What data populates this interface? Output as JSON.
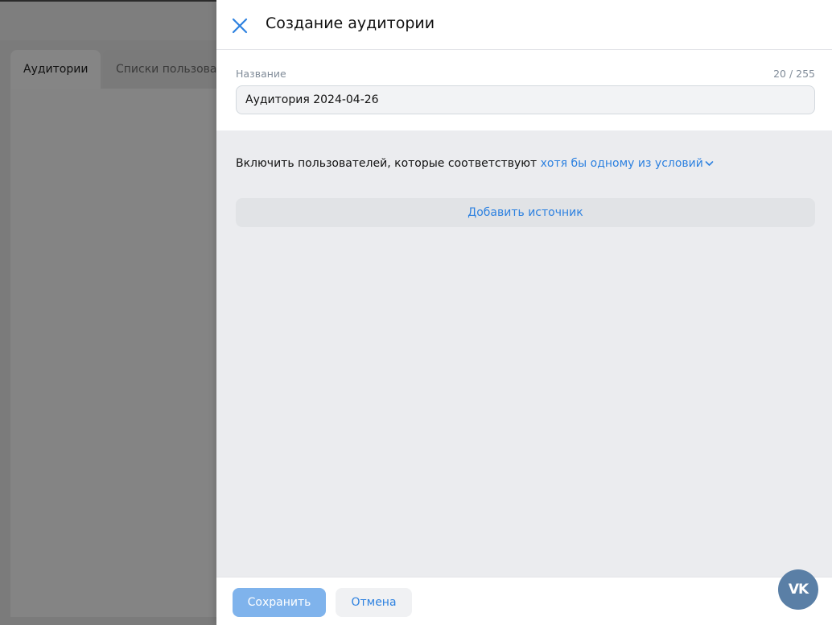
{
  "background": {
    "tabs": [
      {
        "label": "Аудитории",
        "active": true
      },
      {
        "label": "Списки пользоват",
        "active": false
      }
    ]
  },
  "modal": {
    "title": "Создание аудитории",
    "name_field": {
      "label": "Название",
      "counter": "20 / 255",
      "value": "Аудитория 2024-04-26"
    },
    "condition": {
      "prefix": "Включить пользователей, которые соответствуют",
      "selected": "хотя бы одному из условий"
    },
    "add_source_label": "Добавить источник",
    "footer": {
      "save_label": "Сохранить",
      "cancel_label": "Отмена"
    }
  },
  "fab": {
    "label": "VK",
    "icon": "vk-logo-icon"
  },
  "colors": {
    "accent": "#2d81e0",
    "save_button": "#7fb3ec",
    "vk_fab": "#5a7fa6"
  }
}
